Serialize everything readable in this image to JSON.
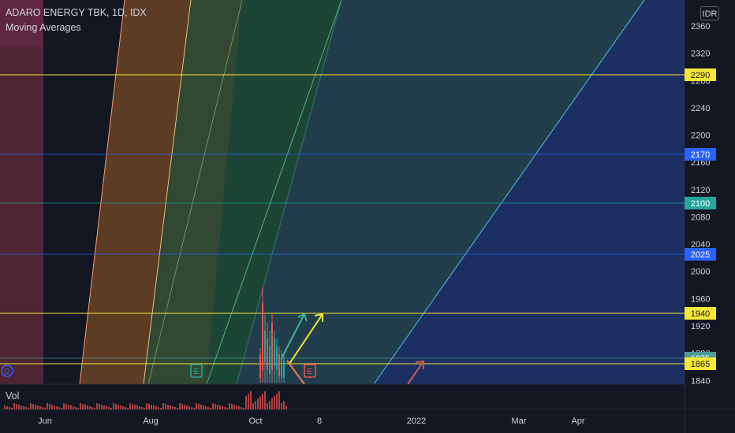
{
  "header": {
    "title": "ADARO ENERGY TBK, 1D, IDX",
    "indicator": "Moving Averages",
    "currency": "IDR"
  },
  "volume_label": "Vol",
  "price_axis": {
    "ticks": [
      "2360",
      "2320",
      "2280",
      "2240",
      "2200",
      "2160",
      "2120",
      "2080",
      "2040",
      "2000",
      "1960",
      "1920",
      "1880",
      "1840"
    ]
  },
  "time_axis": {
    "labels": [
      "Jun",
      "Aug",
      "Oct",
      "8",
      "2022",
      "Mar",
      "Apr"
    ]
  },
  "horizontal_levels": [
    {
      "label": "2290",
      "color": "#f5e735",
      "text_color": "#131722"
    },
    {
      "label": "2170",
      "color": "#2962ff",
      "text_color": "#ffffff"
    },
    {
      "label": "2100",
      "color": "#26a69a",
      "text_color": "#ffffff"
    },
    {
      "label": "2025",
      "color": "#2962ff",
      "text_color": "#ffffff"
    },
    {
      "label": "1940",
      "color": "#f5e735",
      "text_color": "#131722"
    },
    {
      "label": "1875",
      "color": "#4a9d96",
      "text_color": "#ffffff"
    },
    {
      "label": "1865",
      "color": "#f5e735",
      "text_color": "#131722"
    }
  ],
  "markers": [
    {
      "text": "D",
      "color": "#2962ff"
    },
    {
      "text": "E",
      "color": "#26a69a"
    },
    {
      "text": "E",
      "color": "#ef5350"
    }
  ],
  "colors": {
    "background": "#131722",
    "axis_text": "#d1d4dc",
    "grid": "#1e222d",
    "up": "#26a69a",
    "down": "#ef5350"
  },
  "chart_data": {
    "type": "candlestick",
    "title": "ADARO ENERGY TBK, 1D, IDX",
    "ylim": [
      1840,
      2370
    ],
    "x_ticks": [
      "Jun",
      "Aug",
      "Oct",
      "8",
      "2022",
      "Mar",
      "Apr"
    ],
    "horizontal_lines": [
      2290,
      2170,
      2100,
      2025,
      1940,
      1875,
      1865
    ]
  }
}
